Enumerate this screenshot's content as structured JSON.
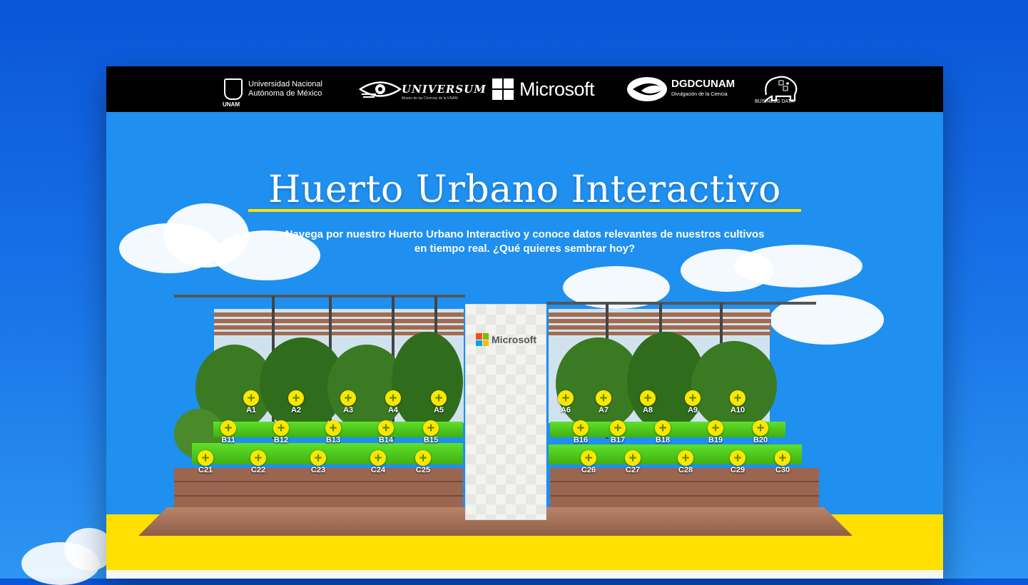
{
  "header": {
    "unam": {
      "line1": "Universidad Nacional",
      "line2": "Autónoma de México",
      "abbr": "UNAM"
    },
    "universum": {
      "name": "UNIVERSUM",
      "sub": "Museo de las Ciencias de la UNAM"
    },
    "microsoft": {
      "name": "Microsoft"
    },
    "dgdc": {
      "name": "DGDCUNAM",
      "sub": "Divulgación de la Ciencia"
    },
    "business_data": {
      "name": "BUSINESS DATA"
    }
  },
  "hero": {
    "title": "Huerto Urbano Interactivo",
    "subtitle_line1": "Navega por nuestro Huerto Urbano Interactivo y conoce datos relevantes de nuestros cultivos",
    "subtitle_line2": "en tiempo real. ¿Qué quieres sembrar hoy?"
  },
  "garden": {
    "wall_logo": "Microsoft",
    "hotspot_icon": "+",
    "hotspots": [
      "A1",
      "A2",
      "A3",
      "A4",
      "A5",
      "A6",
      "A7",
      "A8",
      "A9",
      "A10",
      "B11",
      "B12",
      "B13",
      "B14",
      "B15",
      "B16",
      "B17",
      "B18",
      "B19",
      "B20",
      "C21",
      "C22",
      "C23",
      "C24",
      "C25",
      "C26",
      "C27",
      "C28",
      "C29",
      "C30"
    ]
  },
  "colors": {
    "sky": "#1f8ff0",
    "accent_yellow": "#ffe000",
    "header_bg": "#000000",
    "ms_red": "#f25022",
    "ms_green": "#7fba00",
    "ms_blue": "#00a4ef",
    "ms_yellow": "#ffb900"
  }
}
